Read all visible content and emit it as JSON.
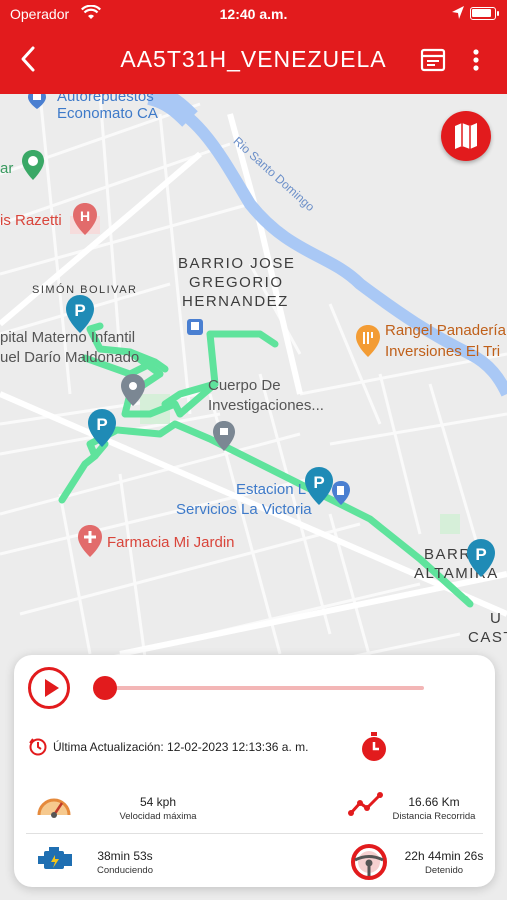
{
  "status_bar": {
    "carrier": "Operador",
    "time": "12:40 a.m."
  },
  "header": {
    "title": "AA5T31H_VENEZUELA"
  },
  "map": {
    "labels": {
      "autorepuestos": "Autorepuestos",
      "economato": "Economato CA",
      "razetti": "is Razetti",
      "ar": "ar",
      "barrio1": "BARRIO JOSE",
      "barrio2": "GREGORIO",
      "barrio3": "HERNANDEZ",
      "simon": "SIMÓN BOLIVAR",
      "hospital1": "pital Materno Infantil",
      "hospital2": "uel Darío Maldonado",
      "cuerpo1": "Cuerpo De",
      "cuerpo2": "Investigaciones...",
      "rangel1": "Rangel Panadería",
      "rangel2": "Inversiones El Tri",
      "estacion1": "Estacion L",
      "estacion2": "Servicios La Victoria",
      "farmacia": "Farmacia Mi Jardin",
      "altamira1": "BARR",
      "altamira2": "ALTAMIRA",
      "u": "U",
      "cast": "CAST",
      "river": "Rio Santo Domingo"
    },
    "colors": {
      "route": "#5fe39c",
      "accent": "#e21b1d",
      "river": "#a9c8f5"
    }
  },
  "panel": {
    "last_update": "Última Actualización: 12-02-2023 12:13:36 a. m.",
    "playback_progress": 0.0,
    "stats": {
      "max_speed": {
        "value": "54 kph",
        "label": "Velocidad máxima"
      },
      "distance": {
        "value": "16.66 Km",
        "label": "Distancia Recorrida"
      },
      "driving": {
        "value": "38min 53s",
        "label": "Conduciendo"
      },
      "stopped": {
        "value": "22h 44min 26s",
        "label": "Detenido"
      }
    }
  }
}
